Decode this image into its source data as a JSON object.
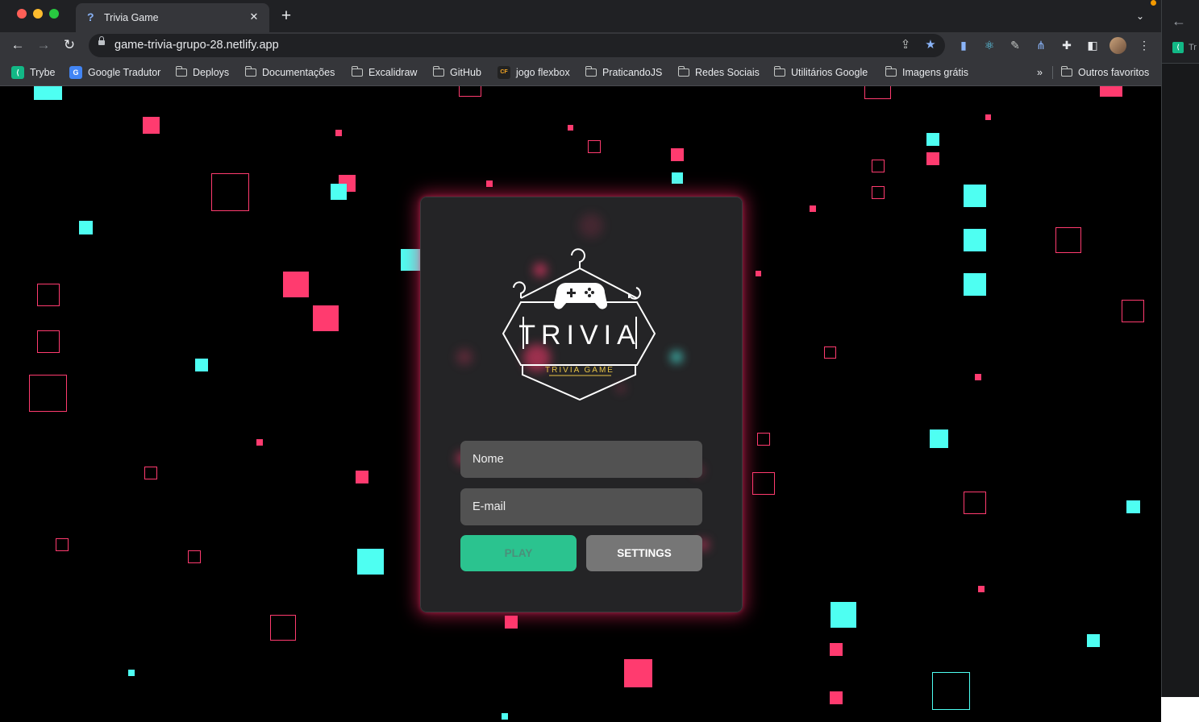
{
  "browser": {
    "tab": {
      "title": "Trivia Game",
      "favicon": "?",
      "close": "✕"
    },
    "new_tab": "+",
    "tab_search": "⌄",
    "nav": {
      "back": "←",
      "forward": "→",
      "reload": "↻"
    },
    "url": "game-trivia-grupo-28.netlify.app",
    "extensions": [
      "share-icon",
      "star-icon",
      "extension-docs-icon",
      "react-devtools-icon",
      "pen-tool-icon",
      "graph-icon",
      "puzzle-icon",
      "sidepanel-icon",
      "profile-avatar",
      "menu-icon"
    ]
  },
  "bookmarks": {
    "items": [
      {
        "label": "Trybe",
        "kind": "favicon",
        "glyph": "⟨",
        "color": "#12b886"
      },
      {
        "label": "Google Tradutor",
        "kind": "favicon",
        "glyph": "G",
        "color": "#4285f4"
      },
      {
        "label": "Deploys",
        "kind": "folder"
      },
      {
        "label": "Documentações",
        "kind": "folder"
      },
      {
        "label": "Excalidraw",
        "kind": "folder"
      },
      {
        "label": "GitHub",
        "kind": "folder"
      },
      {
        "label": "jogo flexbox",
        "kind": "favicon",
        "glyph": "CF",
        "color": "#222222"
      },
      {
        "label": "PraticandoJS",
        "kind": "folder"
      },
      {
        "label": "Redes Sociais",
        "kind": "folder"
      },
      {
        "label": "Utilitários Google",
        "kind": "folder"
      },
      {
        "label": "Imagens grátis",
        "kind": "folder"
      }
    ],
    "overflow": "»",
    "other": "Outros favoritos"
  },
  "game": {
    "logo_title": "TRIVIA",
    "logo_subtitle": "TRIVIA GAME",
    "name_placeholder": "Nome",
    "email_placeholder": "E-mail",
    "play_label": "PLAY",
    "settings_label": "SETTINGS"
  },
  "side_panel": {
    "back": "←",
    "label": "Tr"
  },
  "colors": {
    "accent_pink": "#ff3b6f",
    "accent_cyan": "#4efff2",
    "play_green": "#2bc38f",
    "card": "#262628"
  }
}
